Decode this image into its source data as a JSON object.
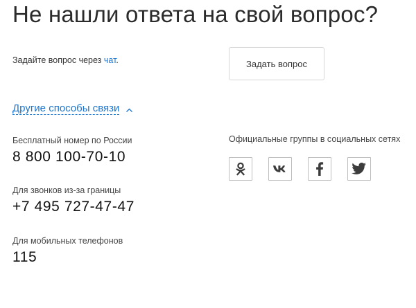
{
  "heading": "Не нашли ответа на свой вопрос?",
  "ask": {
    "prefix": "Задайте вопрос через ",
    "chat_link": "чат",
    "suffix": ".",
    "button_label": "Задать вопрос"
  },
  "other_ways": {
    "label": "Другие способы связи"
  },
  "contacts": [
    {
      "label": "Бесплатный номер по России",
      "phone": "8 800 100-70-10"
    },
    {
      "label": "Для звонков из-за границы",
      "phone": "+7 495 727-47-47"
    },
    {
      "label": "Для мобильных телефонов",
      "phone": "115"
    }
  ],
  "social": {
    "title": "Официальные группы в социальных сетях",
    "networks": [
      {
        "name": "Одноклассники",
        "icon": "odnoklassniki-icon"
      },
      {
        "name": "ВКонтакте",
        "icon": "vk-icon"
      },
      {
        "name": "Facebook",
        "icon": "facebook-icon"
      },
      {
        "name": "Twitter",
        "icon": "twitter-icon"
      }
    ]
  },
  "colors": {
    "link": "#1a75cf",
    "text": "#333333",
    "icon": "#3c3c3c",
    "border": "#bdbdbd"
  }
}
